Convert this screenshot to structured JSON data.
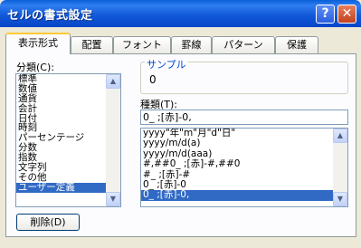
{
  "window": {
    "title": "セルの書式設定"
  },
  "tabs": [
    "表示形式",
    "配置",
    "フォント",
    "罫線",
    "パターン",
    "保護"
  ],
  "category": {
    "label": "分類(C):",
    "items": [
      "標準",
      "数値",
      "通貨",
      "会計",
      "日付",
      "時刻",
      "パーセンテージ",
      "分数",
      "指数",
      "文字列",
      "その他",
      "ユーザー定義"
    ],
    "selected": "ユーザー定義"
  },
  "sample": {
    "legend": "サンプル",
    "value": "0"
  },
  "type": {
    "label": "種類(T):",
    "value": "0_ ;[赤]-0,",
    "items": [
      "yyyy\"年\"m\"月\"d\"日\"",
      "yyyy/m/d(a)",
      "yyyy/m/d(aaa)",
      "#,##0_ ;[赤]-#,##0",
      "#_ ;[赤]-#",
      "0_ ;[赤]-0",
      "0_ ;[赤]-0,"
    ],
    "selected": "0_ ;[赤]-0,"
  },
  "buttons": {
    "delete": "削除(D)"
  }
}
